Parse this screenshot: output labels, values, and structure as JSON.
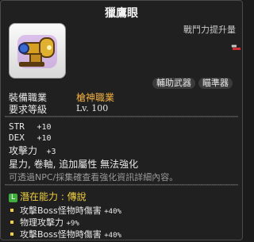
{
  "item": {
    "name": "獵鷹眼",
    "power_label": "戰鬥力提升量",
    "power_value": "-",
    "tags": [
      "輔助武器",
      "瞄準器"
    ]
  },
  "requirements": {
    "job_label": "裝備職業",
    "job_value": "槍神職業",
    "level_label": "要求等級",
    "level_value": "Lv. 100"
  },
  "stats": [
    {
      "name": "STR",
      "value": "+10"
    },
    {
      "name": "DEX",
      "value": "+10"
    },
    {
      "name": "攻擊力",
      "value": "+3"
    }
  ],
  "properties": "星力, 卷軸, 追加屬性 無法強化",
  "note": "可透過NPC/採集確查看強化資訊詳細內容。",
  "potential": {
    "icon": "L",
    "header": "潛在能力 : 傳說",
    "lines": [
      {
        "text": "攻擊Boss怪物時傷害",
        "value": "+40%"
      },
      {
        "text": "物理攻擊力",
        "value": "+9%"
      },
      {
        "text": "攻擊Boss怪物時傷害",
        "value": "+40%"
      }
    ]
  },
  "colors": {
    "job_value": "#f2b040",
    "potential_header": "#f0d040",
    "potential_icon": "#3fae3f"
  }
}
